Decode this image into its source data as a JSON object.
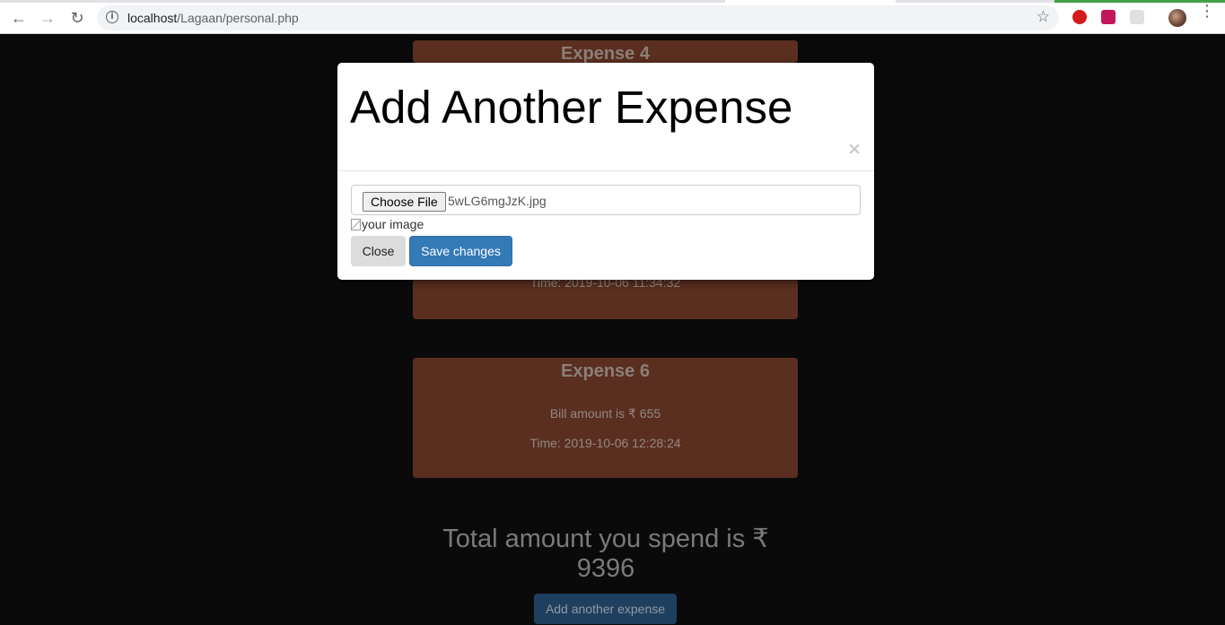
{
  "browser": {
    "url_host": "localhost",
    "url_path": "/Lagaan/personal.php",
    "back_icon": "←",
    "forward_icon": "→",
    "reload_icon": "↻",
    "star_icon": "☆",
    "info_icon": "i",
    "menu_icon": "⋮"
  },
  "cards": {
    "expense4": {
      "title": "Expense 4"
    },
    "expense5": {
      "time": "Time: 2019-10-06 11:34:32"
    },
    "expense6": {
      "title": "Expense 6",
      "amount": "Bill amount is ₹ 655",
      "time": "Time: 2019-10-06 12:28:24"
    }
  },
  "total": {
    "line1": "Total amount you spend is ₹",
    "line2": "9396"
  },
  "add_button": "Add another expense",
  "modal": {
    "title": "Add Another Expense",
    "close_x": "×",
    "file": {
      "button": "Choose File",
      "name": "5wLG6mgJzK.jpg"
    },
    "image_alt": "your image",
    "close_button": "Close",
    "save_button": "Save changes"
  },
  "colors": {
    "card_bg": "#5a2f20",
    "page_bg": "#0a0a0b",
    "primary": "#337ab7"
  }
}
